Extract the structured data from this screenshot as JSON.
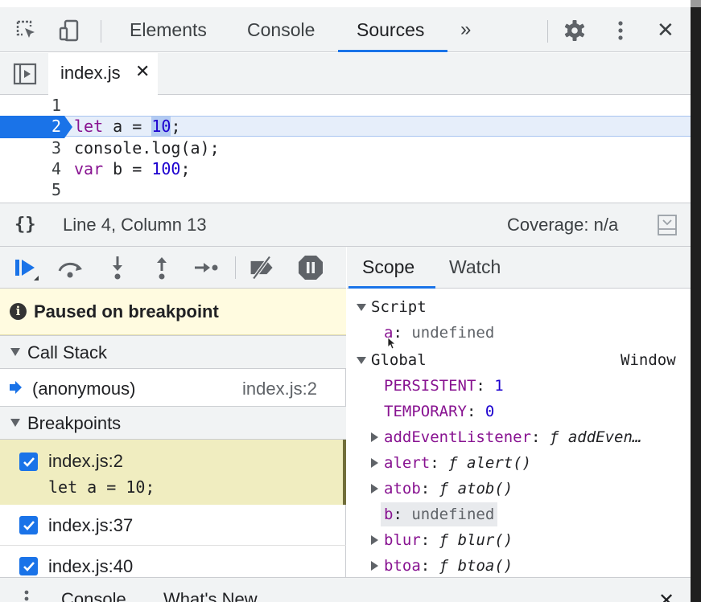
{
  "window": {
    "tabs": [
      {
        "label": "Elements"
      },
      {
        "label": "Console"
      },
      {
        "label": "Sources"
      }
    ],
    "more_tabs": "»",
    "close": "✕"
  },
  "file_tab": {
    "name": "index.js",
    "close": "✕"
  },
  "editor": {
    "lines": [
      {
        "number": "1",
        "code": ""
      },
      {
        "number": "2",
        "code": "let a = 10;"
      },
      {
        "number": "3",
        "code": "console.log(a);"
      },
      {
        "number": "4",
        "code": "var b = 100;"
      },
      {
        "number": "5",
        "code": ""
      }
    ]
  },
  "status_bar": {
    "format_icon": "{}",
    "position": "Line 4, Column 13",
    "coverage": "Coverage: n/a"
  },
  "debugger": {
    "paused_message": "Paused on breakpoint",
    "call_stack_title": "Call Stack",
    "call_stack": [
      {
        "name": "(anonymous)",
        "location": "index.js:2"
      }
    ],
    "breakpoints_title": "Breakpoints",
    "breakpoints": [
      {
        "label": "index.js:2",
        "code": "let a = 10;"
      },
      {
        "label": "index.js:37",
        "code": ""
      },
      {
        "label": "index.js:40",
        "code": ""
      }
    ]
  },
  "right_tabs": {
    "scope": "Scope",
    "watch": "Watch"
  },
  "scope": {
    "script_label": "Script",
    "script_vars": [
      {
        "name": "a",
        "value": "undefined"
      }
    ],
    "global_label": "Global",
    "global_value": "Window",
    "global_vars": [
      {
        "name": "PERSISTENT",
        "value": "1"
      },
      {
        "name": "TEMPORARY",
        "value": "0"
      },
      {
        "name": "addEventListener",
        "f": "ƒ",
        "value": "addEven…"
      },
      {
        "name": "alert",
        "f": "ƒ",
        "value": "alert()"
      },
      {
        "name": "atob",
        "f": "ƒ",
        "value": "atob()"
      },
      {
        "name": "b",
        "value": "undefined"
      },
      {
        "name": "blur",
        "f": "ƒ",
        "value": "blur()"
      },
      {
        "name": "btoa",
        "f": "ƒ",
        "value": "btoa()"
      }
    ]
  },
  "drawer": {
    "tabs": [
      "Console",
      "What's New"
    ],
    "close": "✕"
  },
  "colors": {
    "accent": "#1a73e8",
    "keyword": "#881391",
    "number": "#1c00cf",
    "paused_bg": "#fffbe0"
  }
}
